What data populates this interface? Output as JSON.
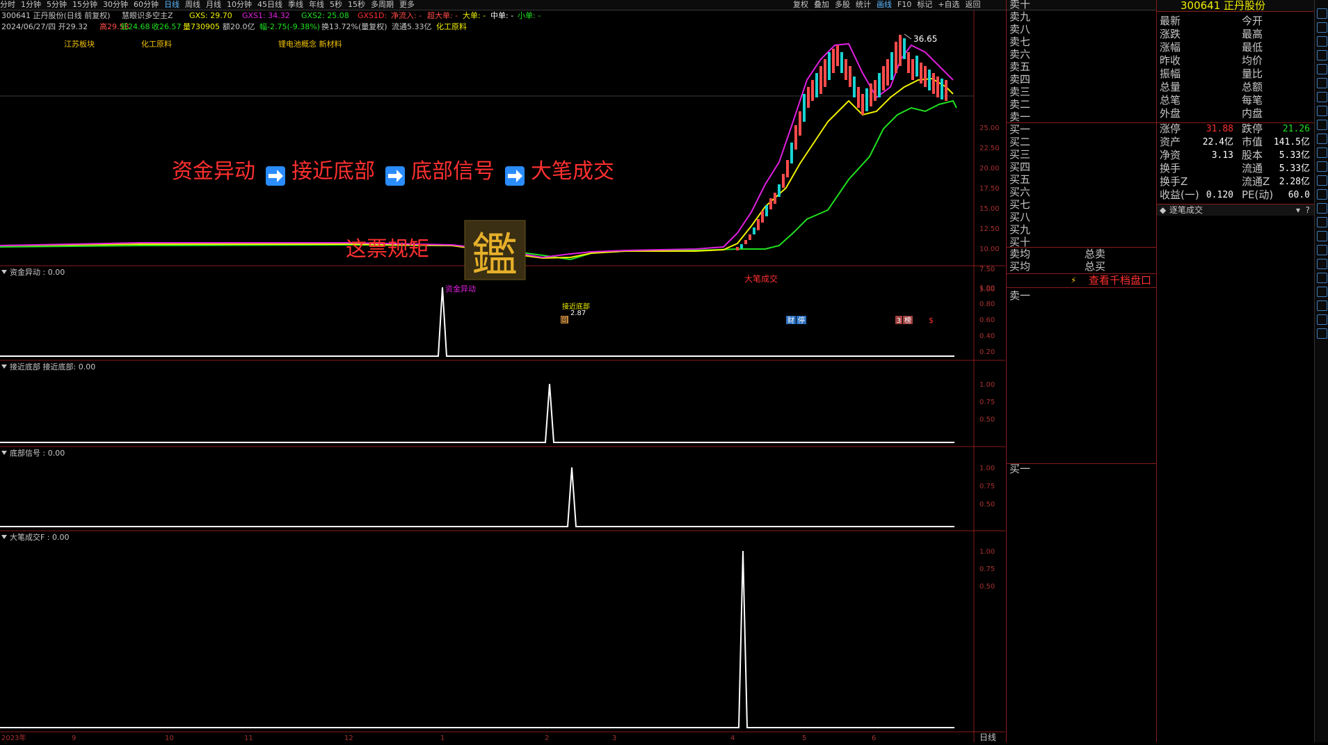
{
  "toolbar": {
    "periods": [
      "分时",
      "1分钟",
      "5分钟",
      "15分钟",
      "30分钟",
      "60分钟",
      "日线",
      "周线",
      "月线",
      "10分钟",
      "45日线",
      "季线",
      "年线",
      "5秒",
      "15秒",
      "多周期",
      "更多"
    ],
    "active_period": "日线",
    "right_tools": [
      "复权",
      "叠加",
      "多股",
      "统计",
      "画线",
      "F10",
      "标记",
      "+自选",
      "返回"
    ]
  },
  "header": {
    "stock_line": "300641 正丹股份(日线 前复权)",
    "indicator_name": "慧眼识多空主Z",
    "gxs": "GXS: 29.70",
    "gxs1": "GXS1: 34.32",
    "gxs2": "GXS2: 25.08",
    "gxs1d": "GXS1D:",
    "net_inflow": "净流入: -",
    "super_big": "超大单: -",
    "big": "大单: -",
    "mid": "中单: -",
    "small": "小单: -",
    "date_line": "2024/06/27/四 开29.32",
    "high": "高29.58",
    "low": "低24.68",
    "close": "收26.57",
    "volume": "量730905",
    "amount": "额20.0亿",
    "change": "幅-2.75(-9.38%)",
    "turnover": "换13.72%(量复权)",
    "float": "流通5.33亿",
    "sector": "化工原料"
  },
  "tags": [
    "江苏板块",
    "化工原料",
    "锂电池概念 新材料"
  ],
  "overlay": {
    "flow": [
      "资金异动",
      "接近底部",
      "底部信号",
      "大笔成交"
    ],
    "arrow": "➡",
    "rule": "这票规矩",
    "seal": "鑑"
  },
  "annotations": {
    "peak": "36.65",
    "big_trade": "大笔成交",
    "fund_move": "资金异动",
    "near_bottom": "接近底部",
    "bottom_price": "2.87",
    "badge1": "财",
    "badge1b": "停",
    "badge2": "3",
    "badge2b": "榜",
    "badge3": "$",
    "marker": "回"
  },
  "price_axis": [
    "25.00",
    "22.50",
    "20.00",
    "17.50",
    "15.00",
    "12.50",
    "10.00",
    "7.50",
    "5.00"
  ],
  "panels": [
    {
      "title": "资金异动 : 0.00",
      "ticks": [
        "1.00",
        "0.80",
        "0.60",
        "0.40",
        "0.20"
      ]
    },
    {
      "title": "接近底部 接近底部: 0.00",
      "ticks": [
        "1.00",
        "0.75",
        "0.50"
      ]
    },
    {
      "title": "底部信号 : 0.00",
      "ticks": [
        "1.00",
        "0.75",
        "0.50"
      ]
    },
    {
      "title": "大笔成交F : 0.00",
      "ticks": [
        "1.00",
        "0.75",
        "0.50"
      ]
    }
  ],
  "time_axis": [
    "2023年",
    "9",
    "10",
    "11",
    "12",
    "1",
    "2",
    "3",
    "4",
    "5",
    "6"
  ],
  "period_label": "日线",
  "orderbook": {
    "sells": [
      "卖十",
      "卖九",
      "卖八",
      "卖七",
      "卖六",
      "卖五",
      "卖四",
      "卖三",
      "卖二",
      "卖一"
    ],
    "buys": [
      "买一",
      "买二",
      "买三",
      "买四",
      "买五",
      "买六",
      "买七",
      "买八",
      "买九",
      "买十"
    ],
    "avg_sell": "卖均",
    "avg_buy": "买均",
    "total_sell": "总卖",
    "total_buy": "总买",
    "view_link": "查看千档盘口",
    "sell_one": "卖一",
    "buy_one": "买一"
  },
  "quote": {
    "title": "300641 正丹股份",
    "grid": [
      [
        "最新",
        "",
        "今开",
        ""
      ],
      [
        "涨跌",
        "",
        "最高",
        ""
      ],
      [
        "涨幅",
        "",
        "最低",
        ""
      ],
      [
        "昨收",
        "",
        "均价",
        ""
      ],
      [
        "振幅",
        "",
        "量比",
        ""
      ],
      [
        "总量",
        "",
        "总额",
        ""
      ],
      [
        "总笔",
        "",
        "每笔",
        ""
      ],
      [
        "外盘",
        "",
        "内盘",
        ""
      ]
    ],
    "stats": [
      [
        "涨停",
        "31.88",
        "跌停",
        "21.26"
      ],
      [
        "资产",
        "22.4亿",
        "市值",
        "141.5亿"
      ],
      [
        "净资",
        "3.13",
        "股本",
        "5.33亿"
      ],
      [
        "换手",
        "",
        "流通",
        "5.33亿"
      ],
      [
        "换手Z",
        "",
        "流通Z",
        "2.28亿"
      ],
      [
        "收益(一)",
        "0.120",
        "PE(动)",
        "60.0"
      ]
    ],
    "tab": "逐笔成交"
  },
  "colors": {
    "up": "#ff4b4b",
    "down": "#19d3d3",
    "magenta": "#e020e0",
    "yellow": "#f0f000",
    "green": "#20e020"
  }
}
